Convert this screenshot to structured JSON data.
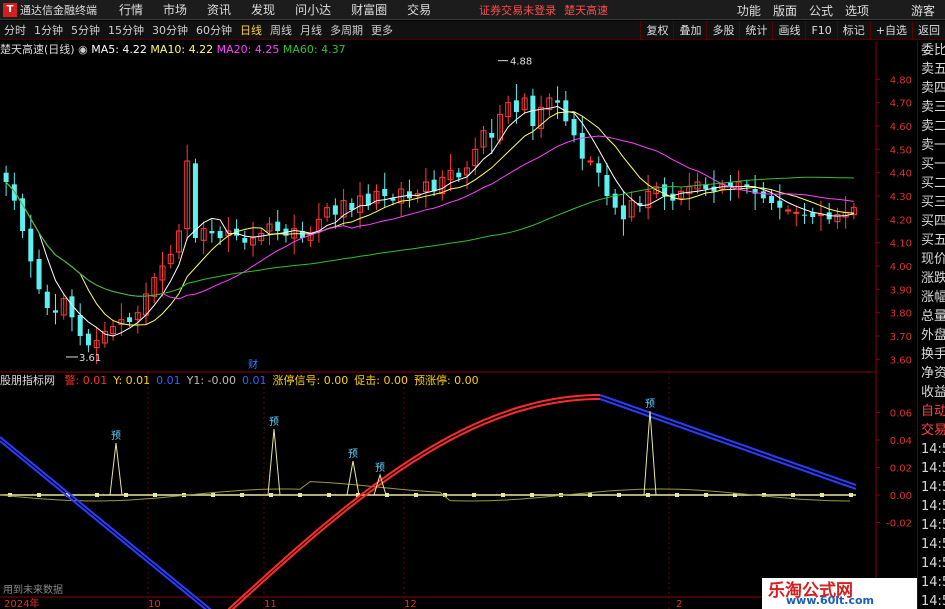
{
  "titlebar": {
    "app": "通达信金融终端",
    "menu": [
      "行情",
      "市场",
      "资讯",
      "发现",
      "问小达",
      "财富圈",
      "交易"
    ],
    "warning": "证券交易未登录",
    "stock": "楚天高速",
    "right": [
      "功能",
      "版面",
      "公式",
      "选项"
    ],
    "guest": "游客"
  },
  "periods": [
    "分时",
    "1分钟",
    "5分钟",
    "15分钟",
    "30分钟",
    "60分钟",
    "日线",
    "周线",
    "月线",
    "多周期",
    "更多"
  ],
  "active_period": "日线",
  "tools": [
    "复权",
    "叠加",
    "多股",
    "统计",
    "画线",
    "F10",
    "标记",
    "+自选",
    "返回"
  ],
  "info": {
    "name": "楚天高速(日线)",
    "ma5": "MA5: 4.22",
    "ma10": "MA10: 4.22",
    "ma20": "MA20: 4.25",
    "ma60": "MA60: 4.37",
    "high_label": "4.88",
    "low_label": "3.61",
    "cai": "财"
  },
  "indicator": {
    "name": "股朋指标网",
    "fields": [
      {
        "label": "警: 0.01",
        "color": "#ff3030"
      },
      {
        "label": "Y: 0.01",
        "color": "#ffd000"
      },
      {
        "label": "0.01",
        "color": "#3060ff"
      },
      {
        "label": "Y1: -0.00",
        "color": "#bbbbbb"
      },
      {
        "label": "0.01",
        "color": "#3060ff"
      },
      {
        "label": "涨停信号: 0.00",
        "color": "#ffd000"
      },
      {
        "label": "促击: 0.00",
        "color": "#ffd000"
      },
      {
        "label": "预涨停: 0.00",
        "color": "#ffd000"
      }
    ],
    "yu": "预",
    "footnote": "用到未来数据"
  },
  "side_items": [
    "委比",
    "卖五",
    "卖四",
    "卖三",
    "卖二",
    "卖一",
    "买一",
    "买二",
    "买三",
    "买四",
    "买五",
    "现价",
    "涨跌",
    "涨幅",
    "总量",
    "外盘",
    "换手",
    "净资",
    "收益",
    "自动",
    "交易",
    "14:56",
    "14:56",
    "14:56",
    "14:56",
    "14:56",
    "14:56",
    "14:56",
    "14:56",
    "14:56"
  ],
  "price_axis": [
    "4.80",
    "4.70",
    "4.60",
    "4.50",
    "4.40",
    "4.30",
    "4.20",
    "4.10",
    "4.00",
    "3.90",
    "3.80",
    "3.70",
    "3.60"
  ],
  "ind_axis": [
    "0.06",
    "0.04",
    "0.02",
    "0.00",
    "-0.02"
  ],
  "date_axis": [
    "2024年",
    "10",
    "11",
    "12",
    "1",
    "2"
  ],
  "watermark": {
    "cn": "乐淘公式网",
    "url": "www.60lt.com"
  },
  "colors": {
    "up": "#ff3a3a",
    "down": "#5ef0f0",
    "ma5": "#ffffff",
    "ma10": "#ffff60",
    "ma20": "#ff40ff",
    "ma60": "#30c030"
  },
  "chart_data": {
    "type": "candlestick",
    "price_range": [
      3.55,
      4.93
    ],
    "closes": [
      4.36,
      4.28,
      4.15,
      4.02,
      3.9,
      3.82,
      3.8,
      3.86,
      3.78,
      3.7,
      3.66,
      3.68,
      3.72,
      3.74,
      3.77,
      3.76,
      3.8,
      3.88,
      3.95,
      4.0,
      4.05,
      4.15,
      4.45,
      4.12,
      4.16,
      4.14,
      4.12,
      4.15,
      4.13,
      4.1,
      4.12,
      4.14,
      4.18,
      4.15,
      4.13,
      4.16,
      4.12,
      4.14,
      4.2,
      4.25,
      4.22,
      4.28,
      4.24,
      4.3,
      4.26,
      4.32,
      4.3,
      4.28,
      4.33,
      4.29,
      4.31,
      4.36,
      4.32,
      4.38,
      4.41,
      4.38,
      4.42,
      4.5,
      4.58,
      4.55,
      4.65,
      4.7,
      4.66,
      4.72,
      4.6,
      4.68,
      4.72,
      4.7,
      4.62,
      4.56,
      4.46,
      4.45,
      4.4,
      4.3,
      4.25,
      4.2,
      4.28,
      4.26,
      4.32,
      4.34,
      4.3,
      4.28,
      4.32,
      4.34,
      4.36,
      4.33,
      4.32,
      4.35,
      4.34,
      4.36,
      4.34,
      4.31,
      4.29,
      4.27,
      4.25,
      4.24,
      4.23,
      4.22,
      4.21,
      4.22,
      4.2,
      4.22,
      4.23,
      4.25
    ]
  }
}
